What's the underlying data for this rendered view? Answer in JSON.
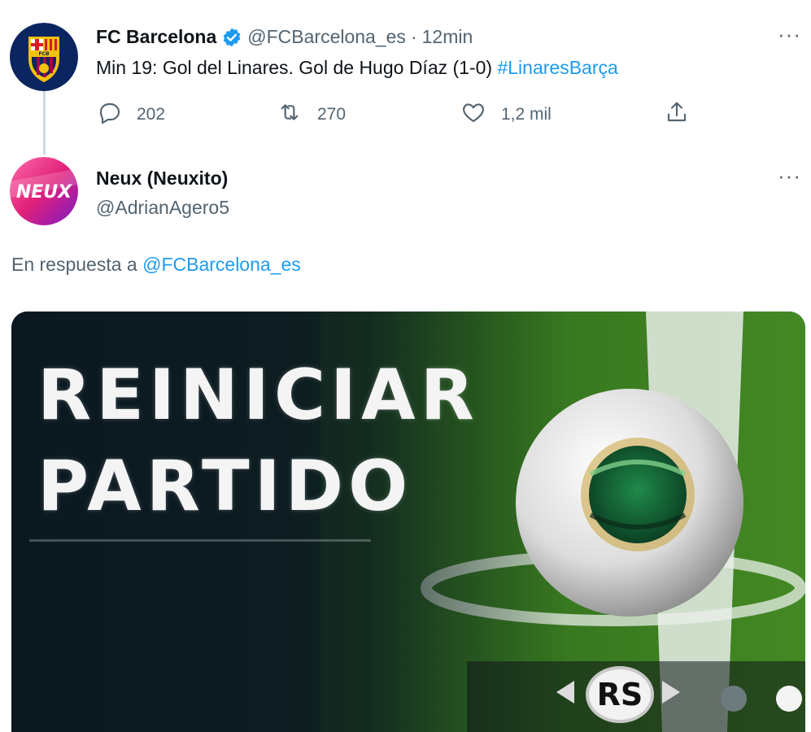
{
  "tweet1": {
    "author_name": "FC Barcelona",
    "handle": "@FCBarcelona_es",
    "separator": "·",
    "time": "12min",
    "text_main": "Min 19: Gol del Linares. Gol de Hugo Díaz (1-0) ",
    "hashtag": "#LinaresBarça",
    "more": "···",
    "stats": {
      "replies": "202",
      "retweets": "270",
      "likes": "1,2 mil"
    },
    "avatar_text": "FCB"
  },
  "tweet2": {
    "author_name": "Neux (Neuxito)",
    "handle": "@AdrianAgero5",
    "more": "···",
    "reply_prefix": "En respuesta a ",
    "reply_mention": "@FCBarcelona_es",
    "avatar_text": "NEUX",
    "media": {
      "line1": "REINICIAR",
      "line2": "PARTIDO",
      "button_label": "RS"
    }
  },
  "colors": {
    "link": "#1d9bf0",
    "secondary_text": "#536471",
    "primary_text": "#0f1419",
    "verified": "#1d9bf0"
  },
  "icons": [
    "reply-icon",
    "retweet-icon",
    "like-icon",
    "share-icon",
    "verified-icon",
    "more-icon"
  ]
}
